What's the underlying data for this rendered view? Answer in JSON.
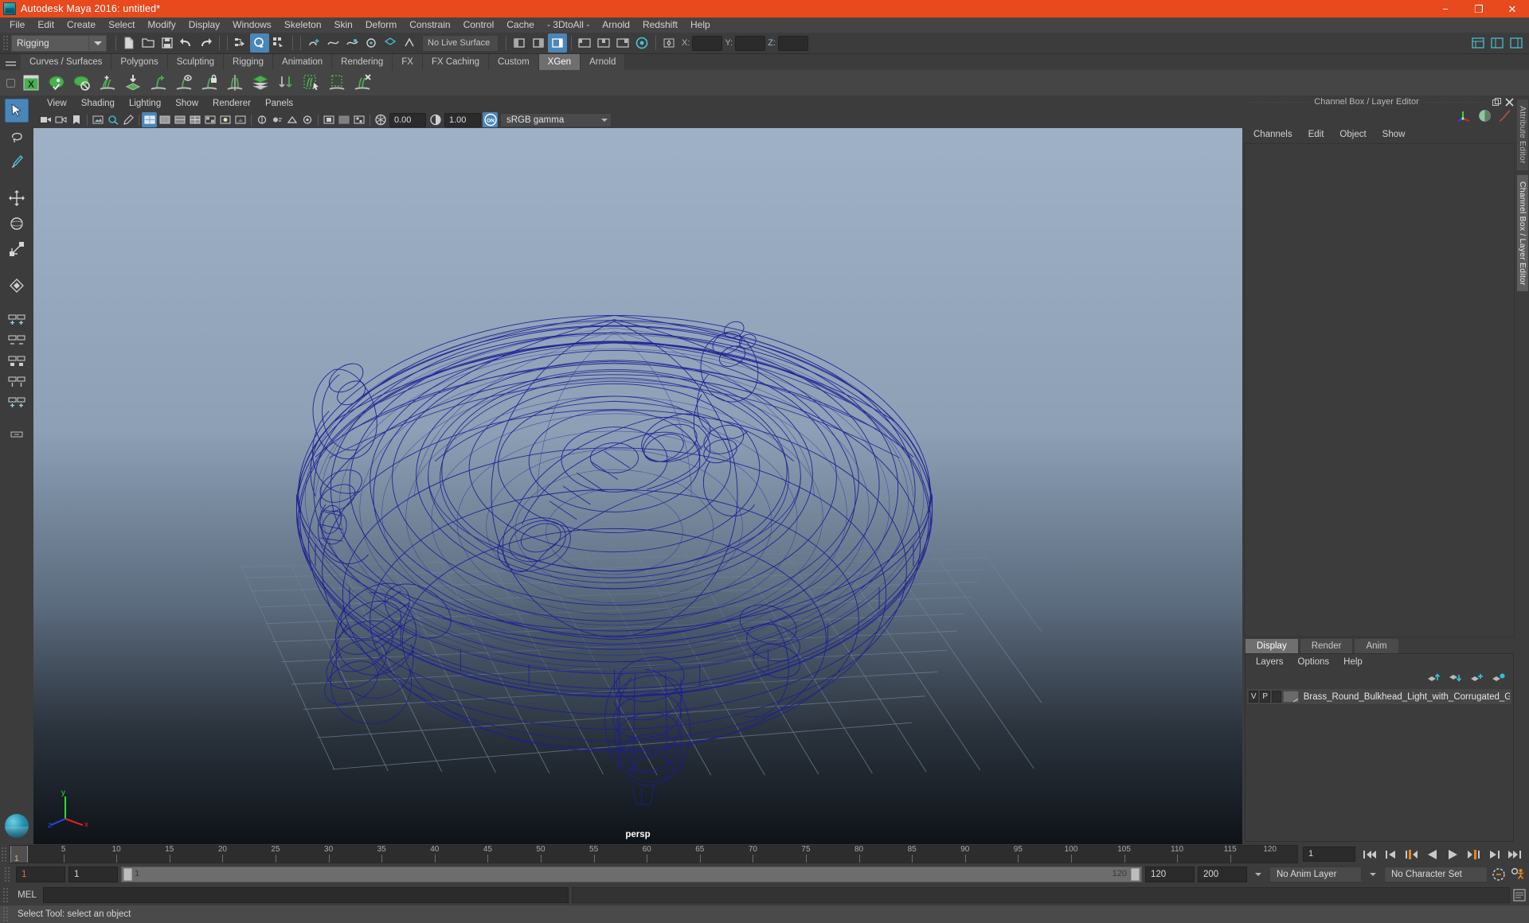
{
  "window": {
    "title": "Autodesk Maya 2016: untitled*",
    "minimize": "−",
    "maximize": "❐",
    "close": "✕"
  },
  "menubar": {
    "items": [
      "File",
      "Edit",
      "Create",
      "Select",
      "Modify",
      "Display",
      "Windows",
      "Skeleton",
      "Skin",
      "Deform",
      "Constrain",
      "Control",
      "Cache",
      "- 3DtoAll -",
      "Arnold",
      "Redshift",
      "Help"
    ]
  },
  "statusline": {
    "menu_set": "Rigging",
    "live_surface": "No Live Surface",
    "coord_labels": {
      "x": "X:",
      "y": "Y:",
      "z": "Z:"
    },
    "coord_values": {
      "x": "",
      "y": "",
      "z": ""
    }
  },
  "shelf": {
    "tabs": [
      "Curves / Surfaces",
      "Polygons",
      "Sculpting",
      "Rigging",
      "Animation",
      "Rendering",
      "FX",
      "FX Caching",
      "Custom",
      "XGen",
      "Arnold"
    ],
    "active_tab": "XGen",
    "icons": [
      "xgen-editor-icon",
      "xgen-preview-visible-icon",
      "xgen-preview-off-icon",
      "xgen-add-description-icon",
      "xgen-import-collection-icon",
      "xgen-add-guide-icon",
      "xgen-guide-visibility-icon",
      "xgen-lock-guide-icon",
      "xgen-mirror-guide-icon",
      "xgen-layers-icon",
      "xgen-convert-icon",
      "xgen-select-region-icon",
      "xgen-region-box-icon",
      "xgen-delete-guide-icon"
    ]
  },
  "toolbox": {
    "tools": [
      "select-tool",
      "lasso-select-tool",
      "paint-select-tool",
      "move-tool",
      "rotate-tool",
      "scale-tool",
      "last-tool-icon",
      "snap-grid-icon",
      "snap-curve-icon",
      "snap-point-icon",
      "snap-view-plane-icon",
      "snap-orient-icon",
      "construction-plane-icon",
      "minimize-toolbox-icon"
    ],
    "selected": "select-tool"
  },
  "viewport": {
    "menus": [
      "View",
      "Shading",
      "Lighting",
      "Show",
      "Renderer",
      "Panels"
    ],
    "exposure": "0.00",
    "gamma": "1.00",
    "color_profile": "sRGB gamma",
    "camera_label": "persp",
    "axis": {
      "x": "x",
      "y": "y",
      "z": "z"
    },
    "model": "wireframe-bulkhead-light",
    "background_top": "#9fb1c6",
    "background_bottom": "#0e1318",
    "wire_color": "#1b1f94"
  },
  "channelbox": {
    "dock_title": "Channel Box / Layer Editor",
    "menus": [
      "Channels",
      "Edit",
      "Object",
      "Show"
    ],
    "icons": [
      "transform-axis-icon",
      "sphere-shading-icon",
      "curve-graph-icon"
    ],
    "undock_icon": "undock-icon",
    "close_icon": "close-icon"
  },
  "layereditor": {
    "tabs": [
      "Display",
      "Render",
      "Anim"
    ],
    "active_tab": "Display",
    "menus": [
      "Layers",
      "Options",
      "Help"
    ],
    "arrow_icons": [
      "move-layer-up-icon",
      "move-layer-down-icon",
      "new-layer-icon",
      "new-layer-from-selected-icon"
    ],
    "layers": [
      {
        "visible": "V",
        "playback": "P",
        "third": "",
        "name": "Brass_Round_Bulkhead_Light_with_Corrugated_Glass_m"
      }
    ]
  },
  "sidetabs": {
    "items": [
      "Attribute Editor",
      "Channel Box / Layer Editor"
    ],
    "active": "Channel Box / Layer Editor"
  },
  "timeline": {
    "current_frame": "1",
    "ticks": [
      5,
      10,
      15,
      20,
      25,
      30,
      35,
      40,
      45,
      50,
      55,
      60,
      65,
      70,
      75,
      80,
      85,
      90,
      95,
      100,
      105,
      110,
      115,
      120
    ],
    "end_label": "120",
    "frame_field": "1",
    "playback_buttons": [
      "go-to-start-icon",
      "step-back-keyframe-icon",
      "step-back-frame-icon",
      "play-backwards-icon",
      "play-forwards-icon",
      "step-forward-frame-icon",
      "step-forward-keyframe-icon",
      "go-to-end-icon"
    ]
  },
  "rangebar": {
    "anim_start": "1",
    "range_start": "1",
    "slider_start_label": "1",
    "slider_end_label": "120",
    "range_end": "120",
    "anim_end": "200",
    "anim_layer": "No Anim Layer",
    "character_set": "No Character Set",
    "auto_key_icon": "auto-keyframe-icon",
    "anim_prefs_icon": "animation-preferences-icon"
  },
  "mel": {
    "label": "MEL",
    "command_value": "",
    "output_value": "",
    "script_editor_icon": "script-editor-icon"
  },
  "statusbar": {
    "message": "Select Tool: select an object"
  },
  "colors": {
    "accent_orange": "#e8491d",
    "highlight_blue": "#4a86b8",
    "panel_bg": "#3c3c3c",
    "xgen_green": "#4caf50"
  }
}
